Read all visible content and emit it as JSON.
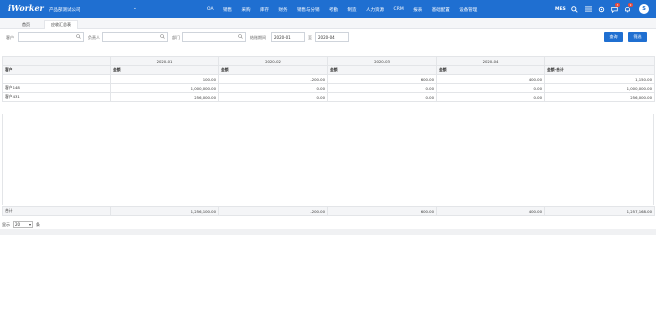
{
  "header": {
    "logo": "iWorker",
    "company": "产品部测试公司",
    "company_chevron": "⌄",
    "nav": [
      "OA",
      "销售",
      "采购",
      "库存",
      "财务",
      "销售与分销",
      "考勤",
      "制造",
      "人力资源",
      "CRM",
      "报表",
      "基础配置",
      "设备管理"
    ],
    "mes": "MES",
    "badge_message": "3",
    "badge_bell": "9",
    "avatar_letter": "S",
    "colors": {
      "bar": "#1f6fd1",
      "badge": "#e74c3c"
    }
  },
  "tabs": [
    "首页",
    "应收汇总表"
  ],
  "filters": {
    "customer_label": "客户",
    "owner_label": "负责人",
    "dept_label": "部门",
    "period_label": "结账期间",
    "period_from": "2020-01",
    "to_label": "至",
    "period_to": "2020-04",
    "query_button": "查询",
    "filter_button": "筛选"
  },
  "table": {
    "periods": [
      "2020-01",
      "2020-02",
      "2020-03",
      "2020-04"
    ],
    "customer_header": "客户",
    "amount_header": "金额",
    "total_header": "金额-合计",
    "rows": [
      {
        "customer": "",
        "values": [
          "100.00",
          "-200.00",
          "600.00",
          "400.00"
        ],
        "total": "1,150.00"
      },
      {
        "customer": "客户148",
        "values": [
          "1,000,000.00",
          "0.00",
          "0.00",
          "0.00"
        ],
        "total": "1,000,000.00"
      },
      {
        "customer": "客户431",
        "values": [
          "256,000.00",
          "0.00",
          "0.00",
          "0.00"
        ],
        "total": "256,000.00"
      }
    ],
    "footer": {
      "label": "合计",
      "values": [
        "1,256,100.00",
        "-200.00",
        "600.00",
        "400.00"
      ],
      "total": "1,257,168.00"
    }
  },
  "pager": {
    "label": "显示",
    "page_size": "20",
    "chevron": "▾",
    "suffix": "条"
  }
}
